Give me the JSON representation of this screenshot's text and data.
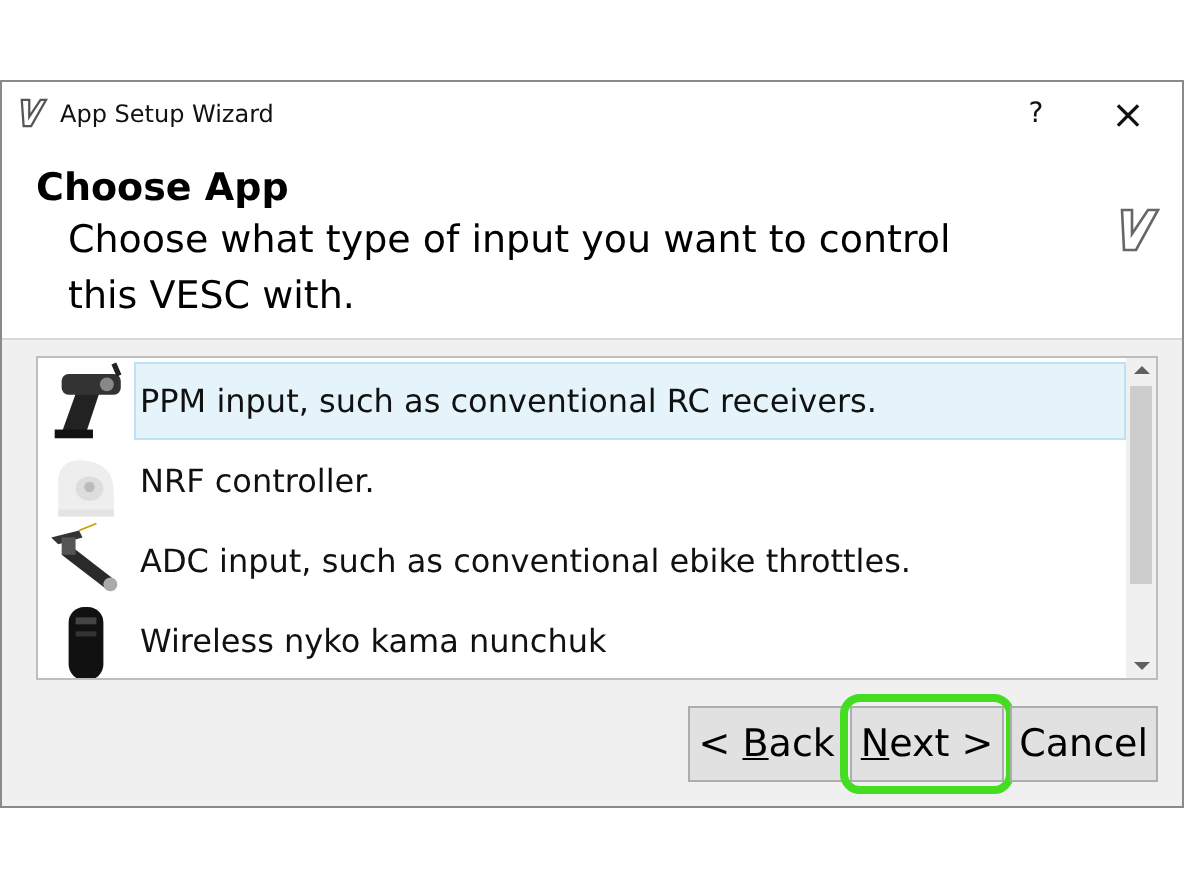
{
  "window": {
    "title": "App Setup Wizard",
    "help": "?",
    "close": "×"
  },
  "header": {
    "title": "Choose App",
    "subtitle": "Choose what type of input you want to control this VESC with."
  },
  "options": [
    {
      "label": "PPM input, such as conventional RC receivers.",
      "selected": true,
      "kind": "picture"
    },
    {
      "label": "NRF controller.",
      "selected": false,
      "kind": "picture"
    },
    {
      "label": "ADC input, such as conventional ebike throttles.",
      "selected": false,
      "kind": "picture"
    },
    {
      "label": "Wireless nyko kama nunchuk",
      "selected": false,
      "kind": "picture"
    }
  ],
  "buttons": [
    {
      "parts": [
        {
          "text": "< ",
          "underlined": false
        },
        {
          "text": "B",
          "underlined": true
        },
        {
          "text": "ack",
          "underlined": false
        }
      ],
      "highlighted": false
    },
    {
      "parts": [
        {
          "text": "N",
          "underlined": true
        },
        {
          "text": "ext >",
          "underlined": false
        }
      ],
      "highlighted": true
    },
    {
      "parts": [
        {
          "text": "Cancel",
          "underlined": false
        }
      ],
      "highlighted": false
    }
  ]
}
